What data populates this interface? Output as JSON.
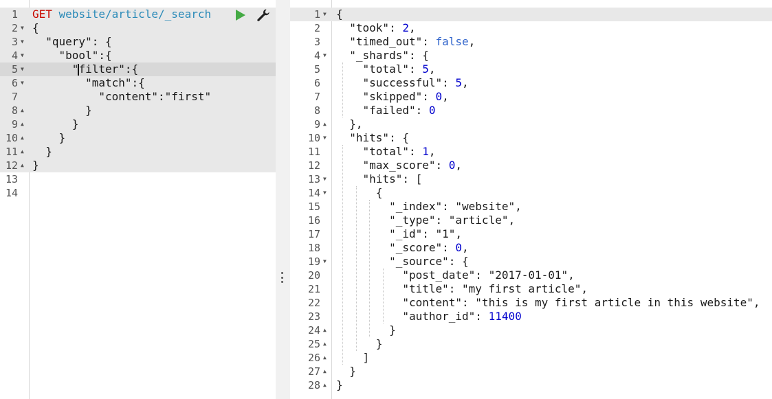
{
  "request": {
    "method": "GET",
    "url": "website/article/_search",
    "lines": [
      {
        "n": "1",
        "fold": "",
        "text": ""
      },
      {
        "n": "2",
        "fold": "down",
        "text": "{"
      },
      {
        "n": "3",
        "fold": "down",
        "text": "  \"query\": {"
      },
      {
        "n": "4",
        "fold": "down",
        "text": "    \"bool\":{"
      },
      {
        "n": "5",
        "fold": "down",
        "text": "filter\":{"
      },
      {
        "n": "6",
        "fold": "down",
        "text": "        \"match\":{"
      },
      {
        "n": "7",
        "fold": "",
        "text": "          \"content\":\"first\""
      },
      {
        "n": "8",
        "fold": "up",
        "text": "        }"
      },
      {
        "n": "9",
        "fold": "up",
        "text": "      }"
      },
      {
        "n": "10",
        "fold": "up",
        "text": "    }"
      },
      {
        "n": "11",
        "fold": "up",
        "text": "  }"
      },
      {
        "n": "12",
        "fold": "up",
        "text": "}"
      },
      {
        "n": "13",
        "fold": "",
        "text": ""
      },
      {
        "n": "14",
        "fold": "",
        "text": ""
      }
    ],
    "line5_prefix": "      \""
  },
  "toolbar": {
    "play_icon": "play-icon",
    "wrench_icon": "wrench-icon",
    "play_color": "#44aa44"
  },
  "response": {
    "lines": [
      {
        "n": "1",
        "fold": "down",
        "parts": [
          [
            "p",
            "{"
          ]
        ]
      },
      {
        "n": "2",
        "fold": "",
        "parts": [
          [
            "p",
            "  "
          ],
          [
            "k",
            "\"took\""
          ],
          [
            "p",
            ": "
          ],
          [
            "num",
            "2"
          ],
          [
            "p",
            ","
          ]
        ]
      },
      {
        "n": "3",
        "fold": "",
        "parts": [
          [
            "p",
            "  "
          ],
          [
            "k",
            "\"timed_out\""
          ],
          [
            "p",
            ": "
          ],
          [
            "bool",
            "false"
          ],
          [
            "p",
            ","
          ]
        ]
      },
      {
        "n": "4",
        "fold": "down",
        "parts": [
          [
            "p",
            "  "
          ],
          [
            "k",
            "\"_shards\""
          ],
          [
            "p",
            ": {"
          ]
        ]
      },
      {
        "n": "5",
        "fold": "",
        "parts": [
          [
            "p",
            "    "
          ],
          [
            "k",
            "\"total\""
          ],
          [
            "p",
            ": "
          ],
          [
            "num",
            "5"
          ],
          [
            "p",
            ","
          ]
        ]
      },
      {
        "n": "6",
        "fold": "",
        "parts": [
          [
            "p",
            "    "
          ],
          [
            "k",
            "\"successful\""
          ],
          [
            "p",
            ": "
          ],
          [
            "num",
            "5"
          ],
          [
            "p",
            ","
          ]
        ]
      },
      {
        "n": "7",
        "fold": "",
        "parts": [
          [
            "p",
            "    "
          ],
          [
            "k",
            "\"skipped\""
          ],
          [
            "p",
            ": "
          ],
          [
            "num",
            "0"
          ],
          [
            "p",
            ","
          ]
        ]
      },
      {
        "n": "8",
        "fold": "",
        "parts": [
          [
            "p",
            "    "
          ],
          [
            "k",
            "\"failed\""
          ],
          [
            "p",
            ": "
          ],
          [
            "num",
            "0"
          ]
        ]
      },
      {
        "n": "9",
        "fold": "up",
        "parts": [
          [
            "p",
            "  },"
          ]
        ]
      },
      {
        "n": "10",
        "fold": "down",
        "parts": [
          [
            "p",
            "  "
          ],
          [
            "k",
            "\"hits\""
          ],
          [
            "p",
            ": {"
          ]
        ]
      },
      {
        "n": "11",
        "fold": "",
        "parts": [
          [
            "p",
            "    "
          ],
          [
            "k",
            "\"total\""
          ],
          [
            "p",
            ": "
          ],
          [
            "num",
            "1"
          ],
          [
            "p",
            ","
          ]
        ]
      },
      {
        "n": "12",
        "fold": "",
        "parts": [
          [
            "p",
            "    "
          ],
          [
            "k",
            "\"max_score\""
          ],
          [
            "p",
            ": "
          ],
          [
            "num",
            "0"
          ],
          [
            "p",
            ","
          ]
        ]
      },
      {
        "n": "13",
        "fold": "down",
        "parts": [
          [
            "p",
            "    "
          ],
          [
            "k",
            "\"hits\""
          ],
          [
            "p",
            ": ["
          ]
        ]
      },
      {
        "n": "14",
        "fold": "down",
        "parts": [
          [
            "p",
            "      {"
          ]
        ]
      },
      {
        "n": "15",
        "fold": "",
        "parts": [
          [
            "p",
            "        "
          ],
          [
            "k",
            "\"_index\""
          ],
          [
            "p",
            ": "
          ],
          [
            "s",
            "\"website\""
          ],
          [
            "p",
            ","
          ]
        ]
      },
      {
        "n": "16",
        "fold": "",
        "parts": [
          [
            "p",
            "        "
          ],
          [
            "k",
            "\"_type\""
          ],
          [
            "p",
            ": "
          ],
          [
            "s",
            "\"article\""
          ],
          [
            "p",
            ","
          ]
        ]
      },
      {
        "n": "17",
        "fold": "",
        "parts": [
          [
            "p",
            "        "
          ],
          [
            "k",
            "\"_id\""
          ],
          [
            "p",
            ": "
          ],
          [
            "s",
            "\"1\""
          ],
          [
            "p",
            ","
          ]
        ]
      },
      {
        "n": "18",
        "fold": "",
        "parts": [
          [
            "p",
            "        "
          ],
          [
            "k",
            "\"_score\""
          ],
          [
            "p",
            ": "
          ],
          [
            "num",
            "0"
          ],
          [
            "p",
            ","
          ]
        ]
      },
      {
        "n": "19",
        "fold": "down",
        "parts": [
          [
            "p",
            "        "
          ],
          [
            "k",
            "\"_source\""
          ],
          [
            "p",
            ": {"
          ]
        ]
      },
      {
        "n": "20",
        "fold": "",
        "parts": [
          [
            "p",
            "          "
          ],
          [
            "k",
            "\"post_date\""
          ],
          [
            "p",
            ": "
          ],
          [
            "s",
            "\"2017-01-01\""
          ],
          [
            "p",
            ","
          ]
        ]
      },
      {
        "n": "21",
        "fold": "",
        "parts": [
          [
            "p",
            "          "
          ],
          [
            "k",
            "\"title\""
          ],
          [
            "p",
            ": "
          ],
          [
            "s",
            "\"my first article\""
          ],
          [
            "p",
            ","
          ]
        ]
      },
      {
        "n": "22",
        "fold": "",
        "parts": [
          [
            "p",
            "          "
          ],
          [
            "k",
            "\"content\""
          ],
          [
            "p",
            ": "
          ],
          [
            "s",
            "\"this is my first article in this website\""
          ],
          [
            "p",
            ","
          ]
        ]
      },
      {
        "n": "23",
        "fold": "",
        "parts": [
          [
            "p",
            "          "
          ],
          [
            "k",
            "\"author_id\""
          ],
          [
            "p",
            ": "
          ],
          [
            "num",
            "11400"
          ]
        ]
      },
      {
        "n": "24",
        "fold": "up",
        "parts": [
          [
            "p",
            "        }"
          ]
        ]
      },
      {
        "n": "25",
        "fold": "up",
        "parts": [
          [
            "p",
            "      }"
          ]
        ]
      },
      {
        "n": "26",
        "fold": "up",
        "parts": [
          [
            "p",
            "    ]"
          ]
        ]
      },
      {
        "n": "27",
        "fold": "up",
        "parts": [
          [
            "p",
            "  }"
          ]
        ]
      },
      {
        "n": "28",
        "fold": "up",
        "parts": [
          [
            "p",
            "}"
          ]
        ]
      }
    ]
  },
  "colors": {
    "method": "#c80a00",
    "url": "#2a8ab8",
    "number": "#0000cd",
    "boolean": "#3366cc",
    "block_highlight": "#e8e8e8",
    "cursor_line": "#d8d8d8"
  }
}
